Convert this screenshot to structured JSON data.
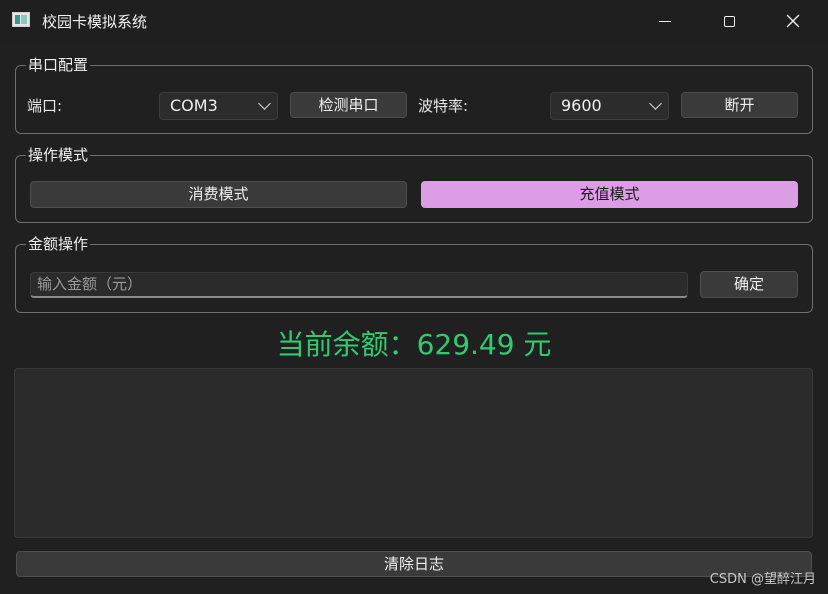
{
  "window": {
    "title": "校园卡模拟系统",
    "minimize_icon": "minimize-icon",
    "maximize_icon": "maximize-icon",
    "close_icon": "close-icon"
  },
  "serial_config": {
    "group_title": "串口配置",
    "port_label": "端口:",
    "port_value": "COM3",
    "detect_button": "检测串口",
    "baud_label": "波特率:",
    "baud_value": "9600",
    "disconnect_button": "断开"
  },
  "mode": {
    "group_title": "操作模式",
    "consume_button": "消费模式",
    "recharge_button": "充值模式",
    "active": "充值模式"
  },
  "amount": {
    "group_title": "金额操作",
    "input_placeholder": "输入金额（元）",
    "input_value": "",
    "confirm_button": "确定"
  },
  "balance": {
    "text": "当前余额：629.49 元"
  },
  "log": {
    "content": ""
  },
  "clear_log_button": "清除日志",
  "watermark": "CSDN @望醉江月",
  "colors": {
    "accent_active": "#dc9de6",
    "balance_green": "#2ecc71",
    "background": "#202020"
  }
}
